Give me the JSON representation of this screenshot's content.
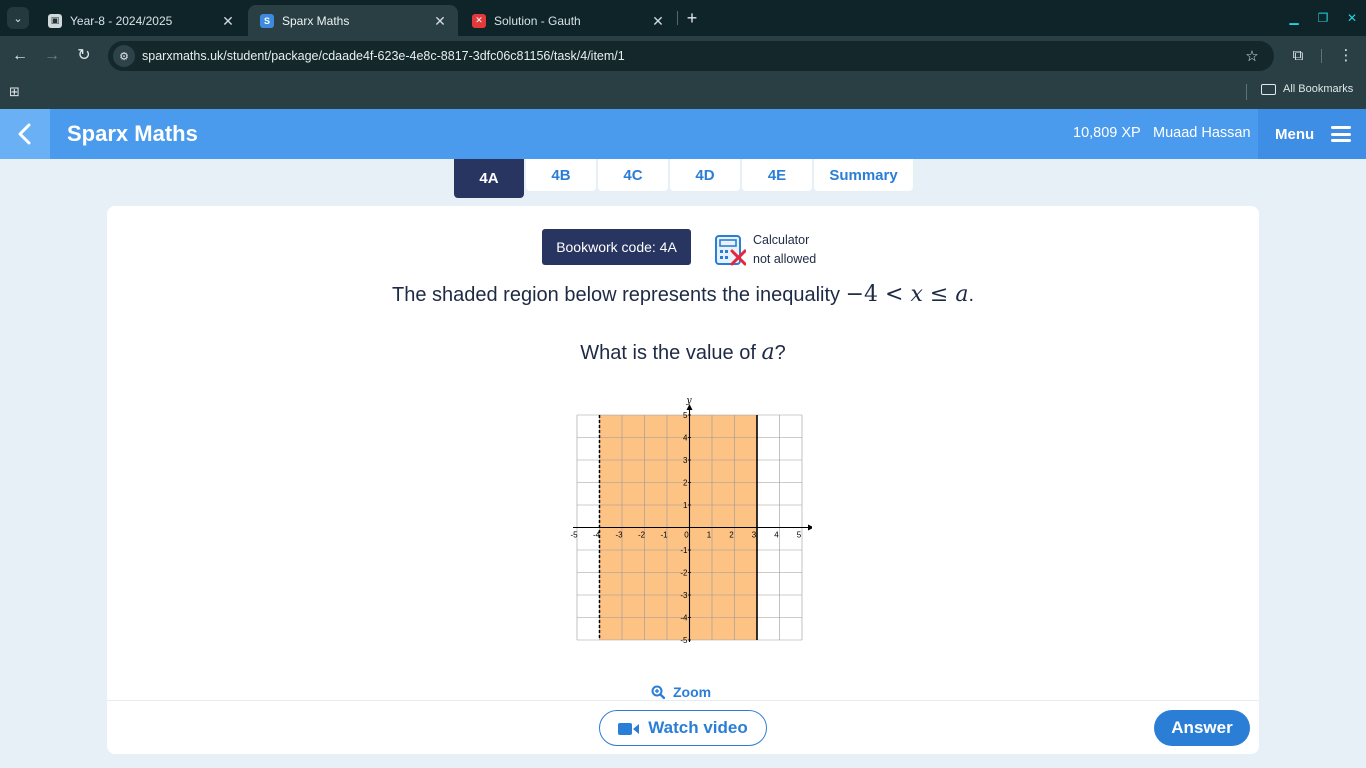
{
  "browser": {
    "tabs": [
      {
        "title": "Year-8 - 2024/2025",
        "favicon": "classroom-icon",
        "active": false
      },
      {
        "title": "Sparx Maths",
        "favicon": "sparx-icon",
        "active": true
      },
      {
        "title": "Solution - Gauth",
        "favicon": "gauth-icon",
        "active": false
      }
    ],
    "url": "sparxmaths.uk/student/package/cdaade4f-623e-4e8c-8817-3dfc06c81156/task/4/item/1",
    "bookmarks_label": "All Bookmarks"
  },
  "header": {
    "title": "Sparx Maths",
    "xp": "10,809 XP",
    "user": "Muaad Hassan",
    "menu_label": "Menu"
  },
  "task_tabs": [
    {
      "label": "4A",
      "active": true
    },
    {
      "label": "4B",
      "active": false
    },
    {
      "label": "4C",
      "active": false
    },
    {
      "label": "4D",
      "active": false
    },
    {
      "label": "4E",
      "active": false
    },
    {
      "label": "Summary",
      "active": false
    }
  ],
  "question": {
    "bookwork_code": "Bookwork code: 4A",
    "calculator_line1": "Calculator",
    "calculator_line2": "not allowed",
    "text_before": "The shaded region below represents the inequality ",
    "inequality_lhs": "−4 < ",
    "inequality_var": "x",
    "inequality_mid": " ≤ ",
    "inequality_rhs": "a",
    "text_after": ".",
    "prompt_before": "What is the value of ",
    "prompt_var": "a",
    "prompt_after": "?"
  },
  "graph": {
    "x_axis_label": "x",
    "y_axis_label": "y",
    "x_ticks": [
      "-5",
      "-4",
      "-3",
      "-2",
      "-1",
      "0",
      "1",
      "2",
      "3",
      "4",
      "5"
    ],
    "y_ticks": [
      "5",
      "4",
      "3",
      "2",
      "1",
      "-1",
      "-2",
      "-3",
      "-4",
      "-5"
    ],
    "x_range": [
      -5,
      5
    ],
    "y_range": [
      -5,
      5
    ],
    "shaded_from": -4,
    "shaded_to": 3,
    "left_boundary": "dashed",
    "right_boundary": "solid",
    "shade_color": "#fdc385"
  },
  "actions": {
    "zoom_label": "Zoom",
    "watch_video_label": "Watch video",
    "answer_label": "Answer"
  },
  "colors": {
    "header_blue": "#4a9aed",
    "navy": "#283560",
    "action_blue": "#2b7ed6"
  }
}
